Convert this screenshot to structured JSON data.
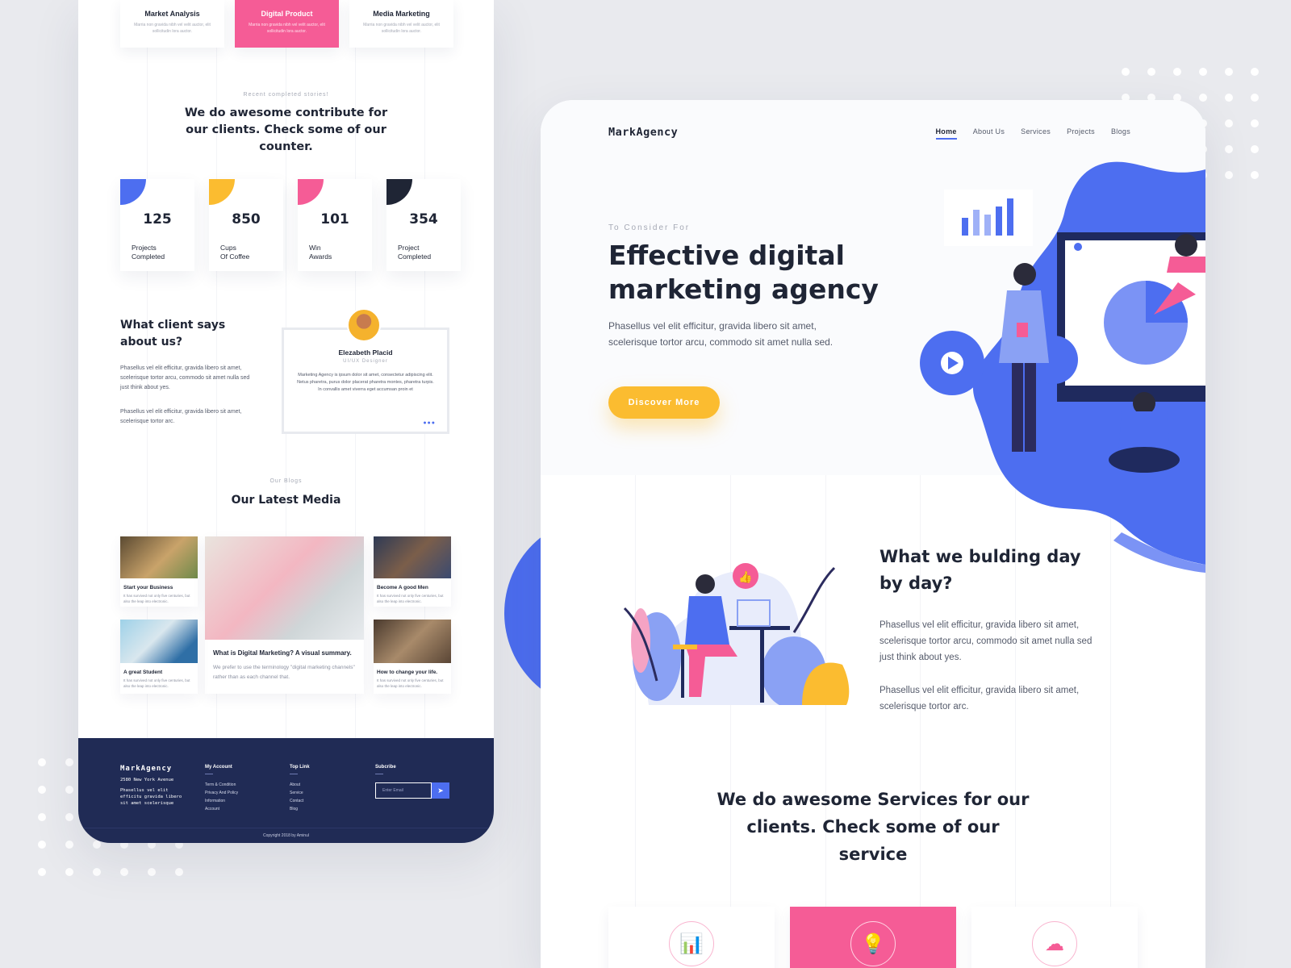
{
  "left": {
    "services": [
      {
        "title": "Market Analysis",
        "desc": "Marria non gravida nibh vel velit auctor, elit sollicitudin lora auctor.",
        "active": false
      },
      {
        "title": "Digital Product",
        "desc": "Marria non gravida nibh vel velit auctor, elit sollicitudin lora auctor.",
        "active": true
      },
      {
        "title": "Media Marketing",
        "desc": "Marria non gravida nibh vel velit auctor, elit sollicitudin lora auctor.",
        "active": false
      }
    ],
    "stories_kicker": "Recent completed stories!",
    "stories_title": "We do awesome contribute for our clients. Check some of our counter.",
    "stats": [
      {
        "number": "125",
        "line1": "Projects",
        "line2": "Completed",
        "color": "#4d6ef0"
      },
      {
        "number": "850",
        "line1": "Cups",
        "line2": "Of Coffee",
        "color": "#fbbc30"
      },
      {
        "number": "101",
        "line1": "Win",
        "line2": "Awards",
        "color": "#f55c96"
      },
      {
        "number": "354",
        "line1": "Project",
        "line2": "Completed",
        "color": "#1f2535"
      }
    ],
    "client_title": "What client says about us?",
    "client_p1": "Phasellus vel elit efficitur, gravida libero sit amet, scelerisque tortor arcu, commodo sit amet nulla sed just think about yes.",
    "client_p2": "Phasellus vel elit efficitur, gravida libero sit amet, scelerisque tortor arc.",
    "testimonial": {
      "name": "Elezabeth Placid",
      "role": "UI/UX Designer",
      "quote": "Marketing Agency is ipsum dolor sit amet, consectetur adipiscing elit. Netus pharetra, purus dolor placerat pharetra montes, pharetra turpis. In convallis amet viverra eget accumsan proin et",
      "pager": "●●●"
    },
    "blog_kicker": "Our Blogs",
    "blog_title": "Our Latest Media",
    "blogs": [
      {
        "title": "Start your Business",
        "desc": "It has survived not only five centuries, but also the leap into electronic."
      },
      {
        "title": "What is Digital Marketing? A visual summary.",
        "desc": "We prefer to use the terminology \"digital marketing channels\" rather than as each channel that."
      },
      {
        "title": "Become A good Men",
        "desc": "It has survived not only five centuries, but also the leap into electronic."
      },
      {
        "title": "A great Student",
        "desc": "It has survived not only five centuries, but also the leap into electronic."
      },
      {
        "title": "How to change your life.",
        "desc": "It has survived not only five centuries, but also the leap into electronic."
      }
    ],
    "footer": {
      "brand": "MarkAgency",
      "address": "2580 New York Avenue",
      "desc": "Phasellus vel elit efficitu gravida libero sit amet scelerisque",
      "col1_title": "My Account",
      "col1": [
        "Term & Condition",
        "Privacy And Policy",
        "Information",
        "Account"
      ],
      "col2_title": "Top Link",
      "col2": [
        "About",
        "Service",
        "Contact",
        "Blog"
      ],
      "subscribe_title": "Subcribe",
      "email_placeholder": "Enter Email",
      "copyright": "Copyright 2018 by Aminul"
    }
  },
  "right": {
    "brand": "MarkAgency",
    "nav": [
      "Home",
      "About Us",
      "Services",
      "Projects",
      "Blogs"
    ],
    "kicker": "To Consider For",
    "headline": "Effective digital marketing agency",
    "hero_text": "Phasellus vel elit efficitur, gravida libero sit amet, scelerisque tortor arcu, commodo sit amet nulla sed.",
    "cta": "Discover More",
    "sec2_title": "What we bulding day by day?",
    "sec2_p1": "Phasellus vel elit efficitur, gravida libero sit amet, scelerisque tortor arcu, commodo sit amet nulla sed just think about yes.",
    "sec2_p2": "Phasellus vel elit efficitur, gravida libero sit amet, scelerisque tortor arc.",
    "sec3_title": "We do awesome Services for our clients. Check some of our service",
    "service_icons": [
      "bar-chart-icon",
      "lightbulb-icon",
      "cloud-icon"
    ]
  },
  "colors": {
    "blue": "#4d6ef0",
    "pink": "#f55c96",
    "yellow": "#fbbc30",
    "navy": "#202b55",
    "dark": "#1f2535"
  }
}
